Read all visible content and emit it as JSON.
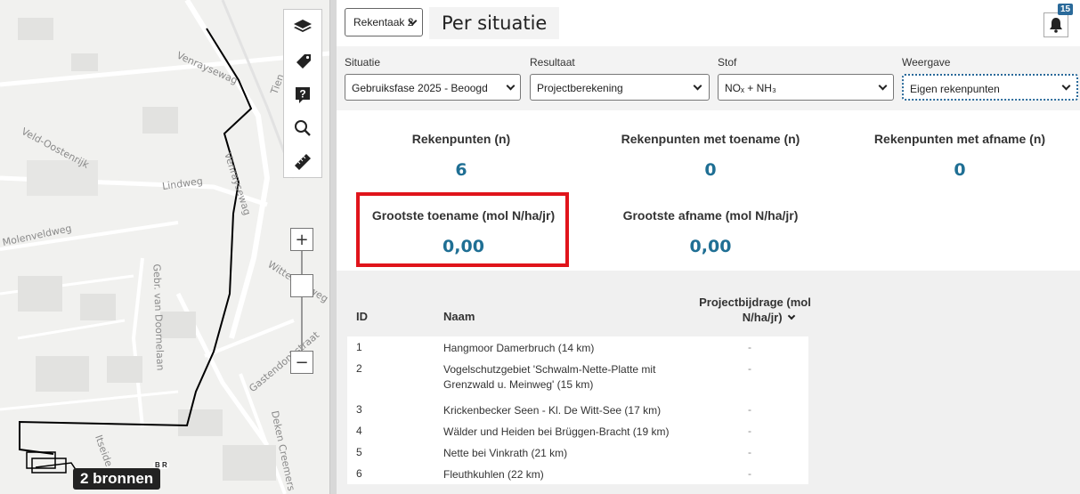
{
  "map": {
    "streets": [
      "Venraysewag",
      "Tien",
      "Veld-Oostenrijk",
      "Lindweg",
      "Venraysewag",
      "Molenveldweg",
      "Gebr. van Doornelaan",
      "Wittebrugweg",
      "Gastendonkstraat",
      "Deken Creemers",
      "Itseide"
    ],
    "sources_badge": "2 bronnen",
    "sources_br": "B R"
  },
  "toolbar": {
    "calc_task": "Rekentaak 2",
    "page_title": "Per situatie",
    "notification_count": "15"
  },
  "filters": {
    "situatie_label": "Situatie",
    "situatie_value": "Gebruiksfase 2025 - Beoogd",
    "resultaat_label": "Resultaat",
    "resultaat_value": "Projectberekening",
    "stof_label": "Stof",
    "stof_value": "NOₓ + NH₃",
    "weergave_label": "Weergave",
    "weergave_value": "Eigen rekenpunten"
  },
  "stats": {
    "rekenpunten_label": "Rekenpunten (n)",
    "rekenpunten_value": "6",
    "toename_label": "Rekenpunten met toename (n)",
    "toename_value": "0",
    "afname_label": "Rekenpunten met afname (n)",
    "afname_value": "0",
    "grootste_toename_label": "Grootste toename (mol N/ha/jr)",
    "grootste_toename_value": "0,00",
    "grootste_afname_label": "Grootste afname (mol N/ha/jr)",
    "grootste_afname_value": "0,00"
  },
  "table": {
    "col_id": "ID",
    "col_naam": "Naam",
    "col_bijdrage_line1": "Projectbijdrage (mol",
    "col_bijdrage_line2": "N/ha/jr)",
    "rows": [
      {
        "id": "1",
        "naam": "Hangmoor Damerbruch (14 km)",
        "waarde": "-"
      },
      {
        "id": "2",
        "naam": "Vogelschutzgebiet 'Schwalm-Nette-Platte mit Grenzwald u. Meinweg' (15 km)",
        "waarde": "-"
      },
      {
        "id": "3",
        "naam": "Krickenbecker Seen - Kl. De Witt-See (17 km)",
        "waarde": "-"
      },
      {
        "id": "4",
        "naam": "Wälder und Heiden bei Brüggen-Bracht (19 km)",
        "waarde": "-"
      },
      {
        "id": "5",
        "naam": "Nette bei Vinkrath (21 km)",
        "waarde": "-"
      },
      {
        "id": "6",
        "naam": "Fleuthkuhlen (22 km)",
        "waarde": "-"
      }
    ]
  }
}
